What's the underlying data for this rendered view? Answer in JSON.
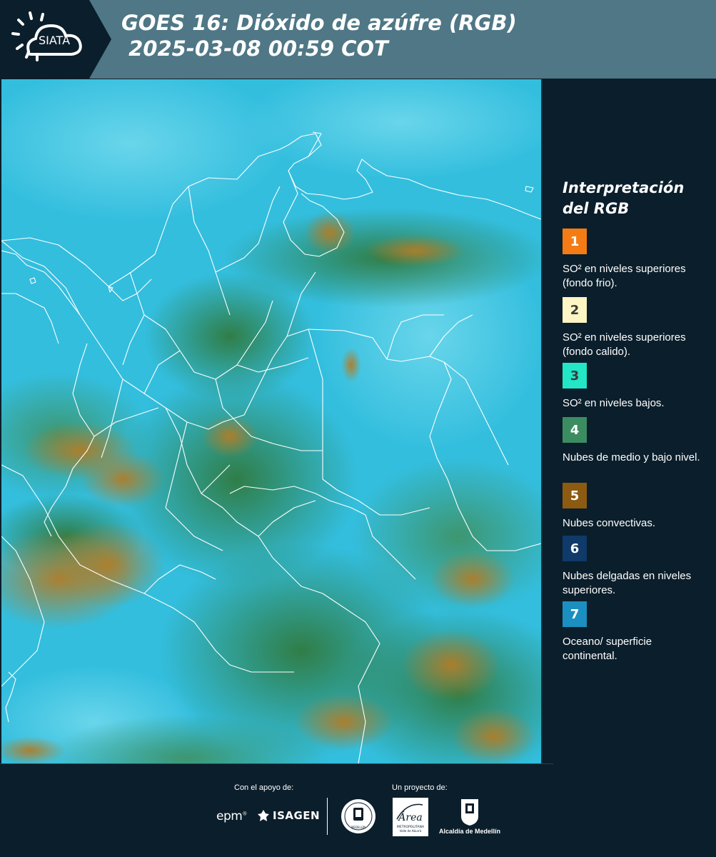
{
  "header": {
    "logo_text": "SIATA",
    "title": "GOES 16: Dióxido de azúfre (RGB)\n 2025-03-08 00:59 COT"
  },
  "map": {
    "description_icon": "satellite-rgb-map"
  },
  "legend": {
    "title": "Interpretación del RGB",
    "items": [
      {
        "number": "1",
        "color": "#f57c14",
        "number_color": "#ffffff",
        "text": "SO² en niveles superiores (fondo frio)."
      },
      {
        "number": "2",
        "color": "#fdf5c4",
        "number_color": "#3a3a3a",
        "text": "SO² en niveles superiores (fondo calido)."
      },
      {
        "number": "3",
        "color": "#22e6c6",
        "number_color": "#3a3a3a",
        "text": "SO² en niveles bajos."
      },
      {
        "number": "4",
        "color": "#3c8c62",
        "number_color": "#ffffff",
        "text": "Nubes de medio y bajo nivel."
      },
      {
        "number": "5",
        "color": "#8d5a12",
        "number_color": "#ffffff",
        "text": "Nubes convectivas."
      },
      {
        "number": "6",
        "color": "#0f3a6a",
        "number_color": "#ffffff",
        "text": "Nubes delgadas en niveles superiores."
      },
      {
        "number": "7",
        "color": "#1b8fbf",
        "number_color": "#ffffff",
        "text": "Oceano/ superficie continental."
      }
    ]
  },
  "footer": {
    "support_label": "Con el apoyo de:",
    "project_label": "Un proyecto de:",
    "epm": "epm",
    "isagen": "ISAGEN",
    "area_name": "Área",
    "area_sub": "METROPOLITANA",
    "area_sub2": "Valle de Aburrá",
    "alcaldia": "Alcaldía de Medellín",
    "seal_text": "MEDELLÍN"
  },
  "colors": {
    "background": "#0b1e2b",
    "header_band": "#4f7786",
    "cyan_sky": "#37c4e4",
    "cloud_green": "#3a8a4a",
    "cloud_brown": "#a87a2a"
  }
}
